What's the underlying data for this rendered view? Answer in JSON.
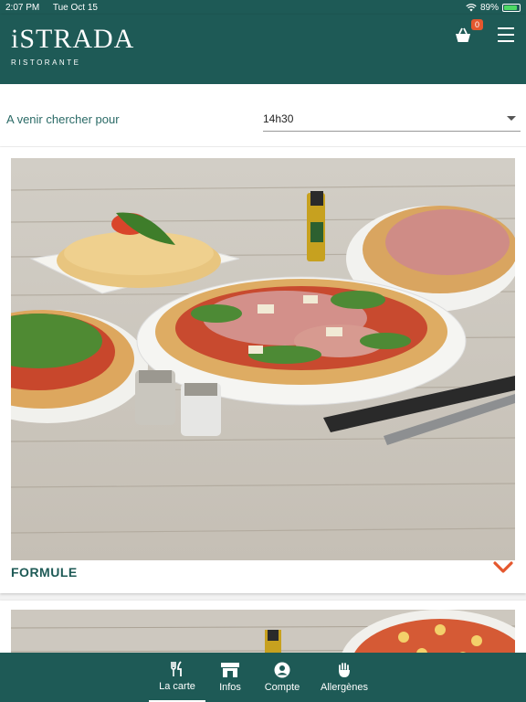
{
  "status_bar": {
    "time": "2:07 PM",
    "date": "Tue Oct 15",
    "battery": "89%"
  },
  "header": {
    "logo_main": "iSTRADA",
    "logo_sub": "RISTORANTE",
    "cart_count": "0"
  },
  "pickup": {
    "label": "A venir chercher pour",
    "time_value": "14h30"
  },
  "menu_cards": [
    {
      "title": "FORMULE"
    },
    {
      "title": ""
    }
  ],
  "bottom_nav": [
    {
      "label": "La carte",
      "icon": "fork-knife-icon",
      "active": true
    },
    {
      "label": "Infos",
      "icon": "store-icon"
    },
    {
      "label": "Compte",
      "icon": "account-icon"
    },
    {
      "label": "Allergènes",
      "icon": "hand-icon"
    }
  ],
  "colors": {
    "primary": "#1e5a56",
    "accent": "#e4572e"
  }
}
